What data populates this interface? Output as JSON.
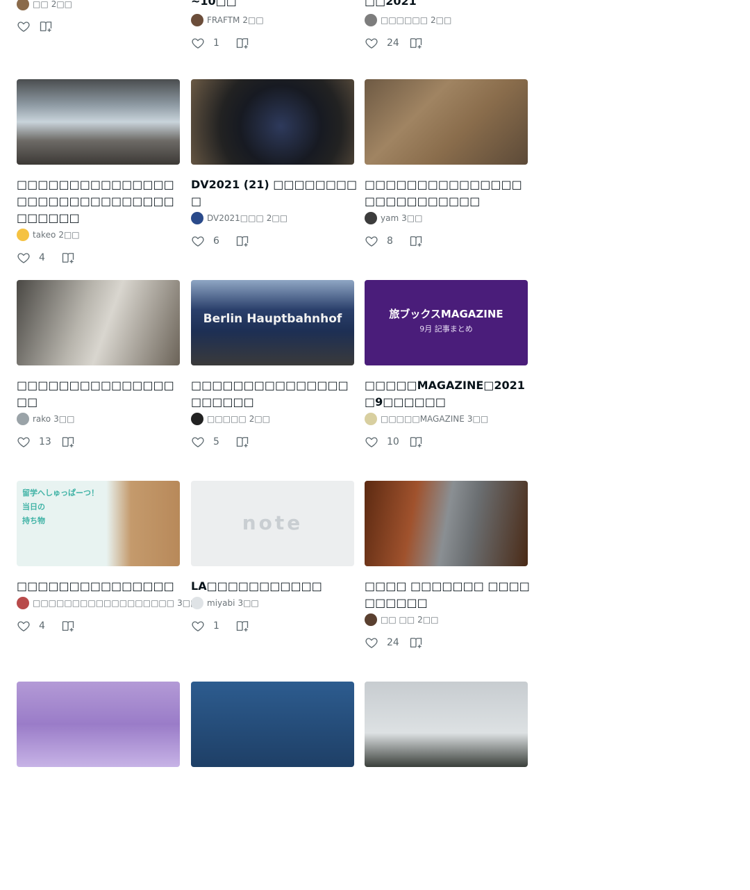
{
  "colors": {
    "text_primary": "#08131a",
    "text_secondary": "#6b7378",
    "icon": "#5e6a70"
  },
  "icons": {
    "like": "heart-outline-icon",
    "save": "add-to-magazine-icon"
  },
  "cards": [
    {
      "row": 0,
      "col": 0,
      "title": "",
      "author_name": "□□",
      "time": "2□□",
      "likes": "",
      "thumb_bg": "",
      "avatar_color": "#8a6a4a"
    },
    {
      "row": 0,
      "col": 1,
      "title": "~10□□",
      "author_name": "FRAFTM",
      "time": "2□□",
      "likes": "1",
      "thumb_bg": "",
      "avatar_color": "#6b4d3a"
    },
    {
      "row": 0,
      "col": 2,
      "title": "□□2021",
      "author_name": "□□□□□□",
      "time": "2□□",
      "likes": "24",
      "thumb_bg": "",
      "avatar_color": "#7d7d7d"
    },
    {
      "row": 1,
      "col": 0,
      "title": "□□□□□□□□□□□□□□□□□□□□□□□□□□□□□□□□□□□□",
      "author_name": "takeo",
      "time": "2□□",
      "likes": "4",
      "avatar_color": "#f5c242",
      "thumb_bg": "linear-gradient(180deg,#4a4d4f 0%,#8e9aa3 30%,#c9d4db 50%,#6d6a66 72%,#3c3936 100%)"
    },
    {
      "row": 1,
      "col": 1,
      "title": "DV2021 (21) □□□□□□□□□",
      "author_name": "DV2021□□□",
      "time": "2□□",
      "likes": "6",
      "avatar_color": "#2a4a8a",
      "thumb_bg": "radial-gradient(circle at 55% 55%,#2e3a5c 0%,#171a22 40%,#222 60%,#6b5a45 100%)"
    },
    {
      "row": 1,
      "col": 2,
      "title": "□□□□□□□□□□□□□□□□□□□□□□□□□□",
      "author_name": "yam",
      "time": "3□□",
      "likes": "8",
      "avatar_color": "#3c3c3c",
      "thumb_bg": "linear-gradient(135deg,#6e5a44 0%,#a08462 35%,#8a6d4c 60%,#5c4a38 100%)"
    },
    {
      "row": 2,
      "col": 0,
      "title": "□□□□□□□□□□□□□□□□□",
      "author_name": "rako",
      "time": "3□□",
      "likes": "13",
      "avatar_color": "#9aa3a8",
      "thumb_bg": "linear-gradient(110deg,#4a4844 0%,#b8b5ad 40%,#d9d6cf 55%,#6b6358 100%)"
    },
    {
      "row": 2,
      "col": 1,
      "title": "□□□□□□□□□□□□□□□□□□□□□",
      "author_name": "□□□□□",
      "time": "2□□",
      "likes": "5",
      "avatar_color": "#222222",
      "thumb_bg": "linear-gradient(180deg,#8fa6c4 0%,#2a3f6b 35%,#1d2f54 60%,#3a3a3a 100%)",
      "thumb_label": "Berlin Hauptbahnhof"
    },
    {
      "row": 2,
      "col": 2,
      "title": "□□□□□MAGAZINE□2021□9□□□□□□",
      "author_name": "□□□□□MAGAZINE",
      "time": "3□□",
      "likes": "10",
      "avatar_color": "#d8cfa0",
      "thumb_bg": "#4a1d7a",
      "thumb_label": "旅ブックスMAGAZINE",
      "thumb_sub": "9月 記事まとめ"
    },
    {
      "row": 3,
      "col": 0,
      "title": "□□□□□□□□□□□□□□□",
      "author_name": "□□□□□□□□□□□□□□□□□□",
      "time": "3□□",
      "likes": "4",
      "avatar_color": "#b84a4a",
      "thumb_bg": "linear-gradient(90deg,#e8f3f1 0%,#e8f3f1 55%,#c49a6c 70%,#b8895a 100%)",
      "thumb_overlay": "留学へしゅっぱーつ！\n当日の\n持ち物"
    },
    {
      "row": 3,
      "col": 1,
      "title": "LA□□□□□□□□□□□",
      "author_name": "miyabi",
      "time": "3□□",
      "likes": "1",
      "avatar_color": "#dfe3e6",
      "thumb_bg": "#eceeef",
      "thumb_wordmark": "note"
    },
    {
      "row": 3,
      "col": 2,
      "title": "□□□□ □□□□□□□ □□□□□□□□□□",
      "author_name": "□□ □□",
      "time": "2□□",
      "likes": "24",
      "avatar_color": "#5a4030",
      "thumb_bg": "linear-gradient(100deg,#5c2a12 0%,#a0522d 30%,#8a8f93 50%,#6b6f72 65%,#4a2a16 100%)"
    },
    {
      "row": 4,
      "col": 0,
      "title": "",
      "author_name": "",
      "time": "",
      "likes": "",
      "avatar_color": "",
      "thumb_bg": "linear-gradient(180deg,#b39ad6 0%,#9a7cc8 50%,#c7b3e6 100%)"
    },
    {
      "row": 4,
      "col": 1,
      "title": "",
      "author_name": "",
      "time": "",
      "likes": "",
      "avatar_color": "",
      "thumb_bg": "linear-gradient(180deg,#2d5c8f 0%,#1e3f66 100%)"
    },
    {
      "row": 4,
      "col": 2,
      "title": "",
      "author_name": "",
      "time": "",
      "likes": "",
      "avatar_color": "",
      "thumb_bg": "linear-gradient(180deg,#c7ccd0 0%,#dde1e3 60%,#3a3f3a 100%)"
    }
  ]
}
